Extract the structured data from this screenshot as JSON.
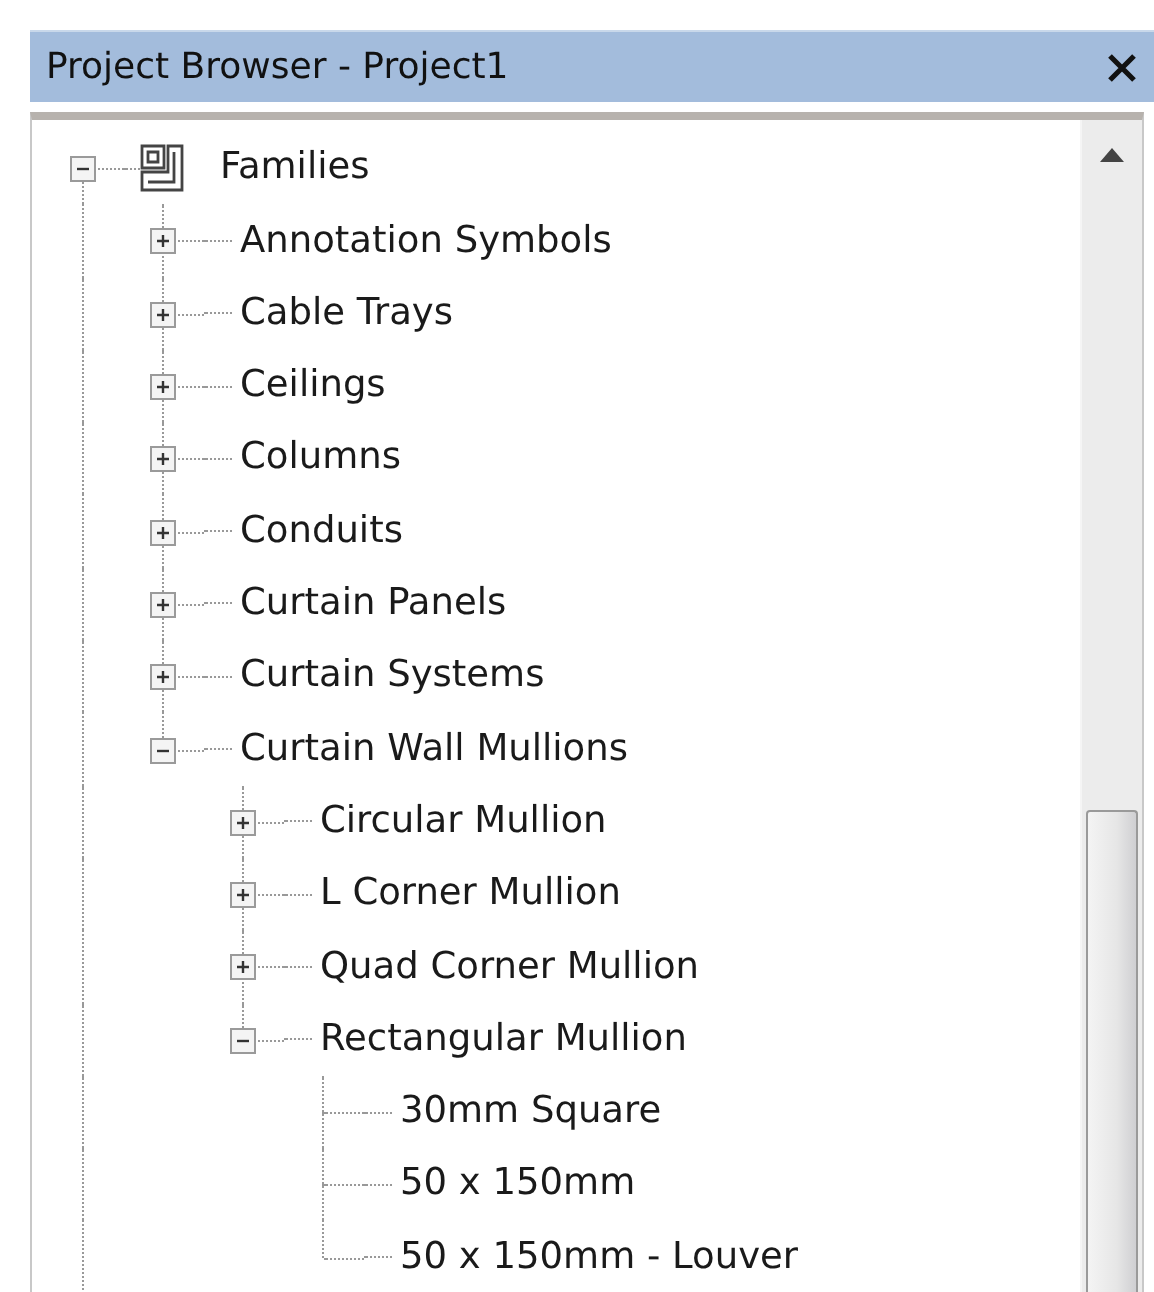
{
  "window": {
    "title": "Project Browser - Project1"
  },
  "tree": [
    {
      "label": "Families",
      "kind": "family",
      "expanded": true,
      "children": [
        {
          "label": "Annotation Symbols",
          "expanded": false
        },
        {
          "label": "Cable Trays",
          "expanded": false
        },
        {
          "label": "Ceilings",
          "expanded": false
        },
        {
          "label": "Columns",
          "expanded": false
        },
        {
          "label": "Conduits",
          "expanded": false
        },
        {
          "label": "Curtain Panels",
          "expanded": false
        },
        {
          "label": "Curtain Systems",
          "expanded": false
        },
        {
          "label": "Curtain Wall Mullions",
          "expanded": true,
          "children": [
            {
              "label": "Circular Mullion",
              "expanded": false
            },
            {
              "label": "L Corner Mullion",
              "expanded": false
            },
            {
              "label": "Quad Corner Mullion",
              "expanded": false
            },
            {
              "label": "Rectangular Mullion",
              "expanded": true,
              "children": [
                {
                  "label": "30mm Square"
                },
                {
                  "label": "50 x 150mm"
                },
                {
                  "label": "50 x 150mm - Louver"
                }
              ]
            }
          ]
        }
      ]
    }
  ]
}
